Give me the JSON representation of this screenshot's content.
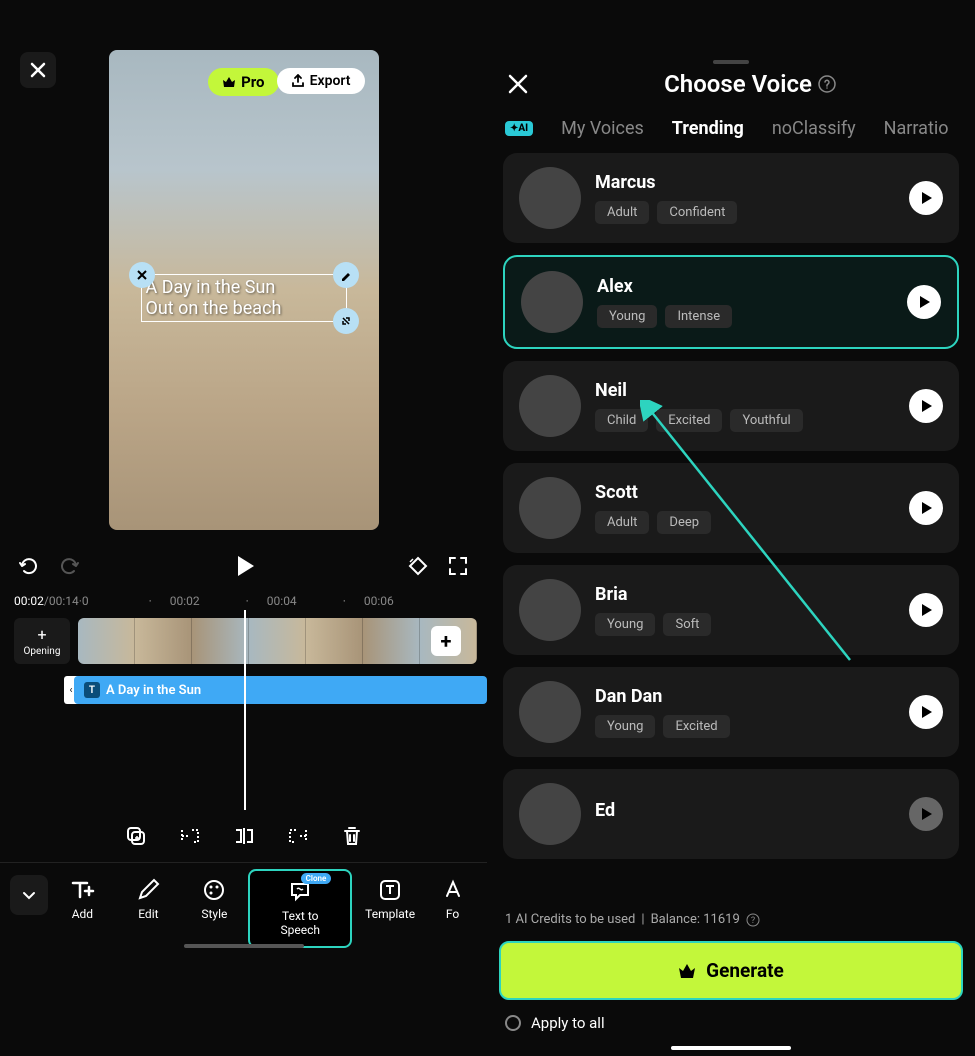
{
  "left": {
    "pro_label": "Pro",
    "export_label": "Export",
    "text_overlay": {
      "line1": "A Day in the Sun",
      "line2": "Out on the beach"
    },
    "timeline": {
      "current": "00:02",
      "total": "00:14",
      "frame": "0",
      "ticks": [
        "00:02",
        "00:04",
        "00:06"
      ],
      "opening_label": "Opening",
      "text_clip_label": "A Day in the Sun"
    },
    "nav": {
      "add": "Add",
      "edit": "Edit",
      "style": "Style",
      "tts": "Text to Speech",
      "tts_badge": "Clone",
      "template": "Template",
      "font_partial": "Fo"
    }
  },
  "right": {
    "title": "Choose Voice",
    "tabs": {
      "my_voices": "My Voices",
      "trending": "Trending",
      "no_classify": "noClassify",
      "narration": "Narratio"
    },
    "voices": [
      {
        "name": "Marcus",
        "tags": [
          "Adult",
          "Confident"
        ],
        "selected": false
      },
      {
        "name": "Alex",
        "tags": [
          "Young",
          "Intense"
        ],
        "selected": true
      },
      {
        "name": "Neil",
        "tags": [
          "Child",
          "Excited",
          "Youthful"
        ],
        "selected": false
      },
      {
        "name": "Scott",
        "tags": [
          "Adult",
          "Deep"
        ],
        "selected": false
      },
      {
        "name": "Bria",
        "tags": [
          "Young",
          "Soft"
        ],
        "selected": false
      },
      {
        "name": "Dan Dan",
        "tags": [
          "Young",
          "Excited"
        ],
        "selected": false
      },
      {
        "name": "Ed",
        "tags": [],
        "selected": false,
        "dim": true
      }
    ],
    "credits": {
      "used_label": "1 AI Credits to be used",
      "balance_label": "Balance: 11619"
    },
    "generate_label": "Generate",
    "apply_all_label": "Apply to all"
  }
}
